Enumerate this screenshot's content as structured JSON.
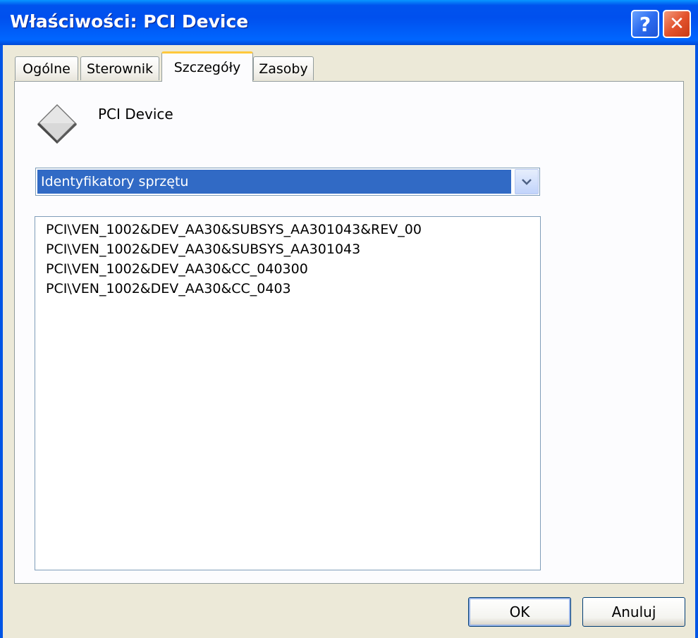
{
  "window": {
    "title": "Właściwości: PCI Device",
    "help_label": "?",
    "close_label": "✕"
  },
  "tabs": [
    {
      "label": "Ogólne",
      "active": false
    },
    {
      "label": "Sterownik",
      "active": false
    },
    {
      "label": "Szczegóły",
      "active": true
    },
    {
      "label": "Zasoby",
      "active": false
    }
  ],
  "details": {
    "device_icon": "pci-device-icon",
    "device_name": "PCI Device",
    "property_dropdown": {
      "selected": "Identyfikatory sprzętu"
    },
    "values": [
      "PCI\\VEN_1002&DEV_AA30&SUBSYS_AA301043&REV_00",
      "PCI\\VEN_1002&DEV_AA30&SUBSYS_AA301043",
      "PCI\\VEN_1002&DEV_AA30&CC_040300",
      "PCI\\VEN_1002&DEV_AA30&CC_0403"
    ]
  },
  "buttons": {
    "ok_label": "OK",
    "cancel_label": "Anuluj"
  },
  "colors": {
    "titlebar": "#0055e5",
    "selection": "#316ac5",
    "active_tab_accent": "#ffc83c"
  }
}
